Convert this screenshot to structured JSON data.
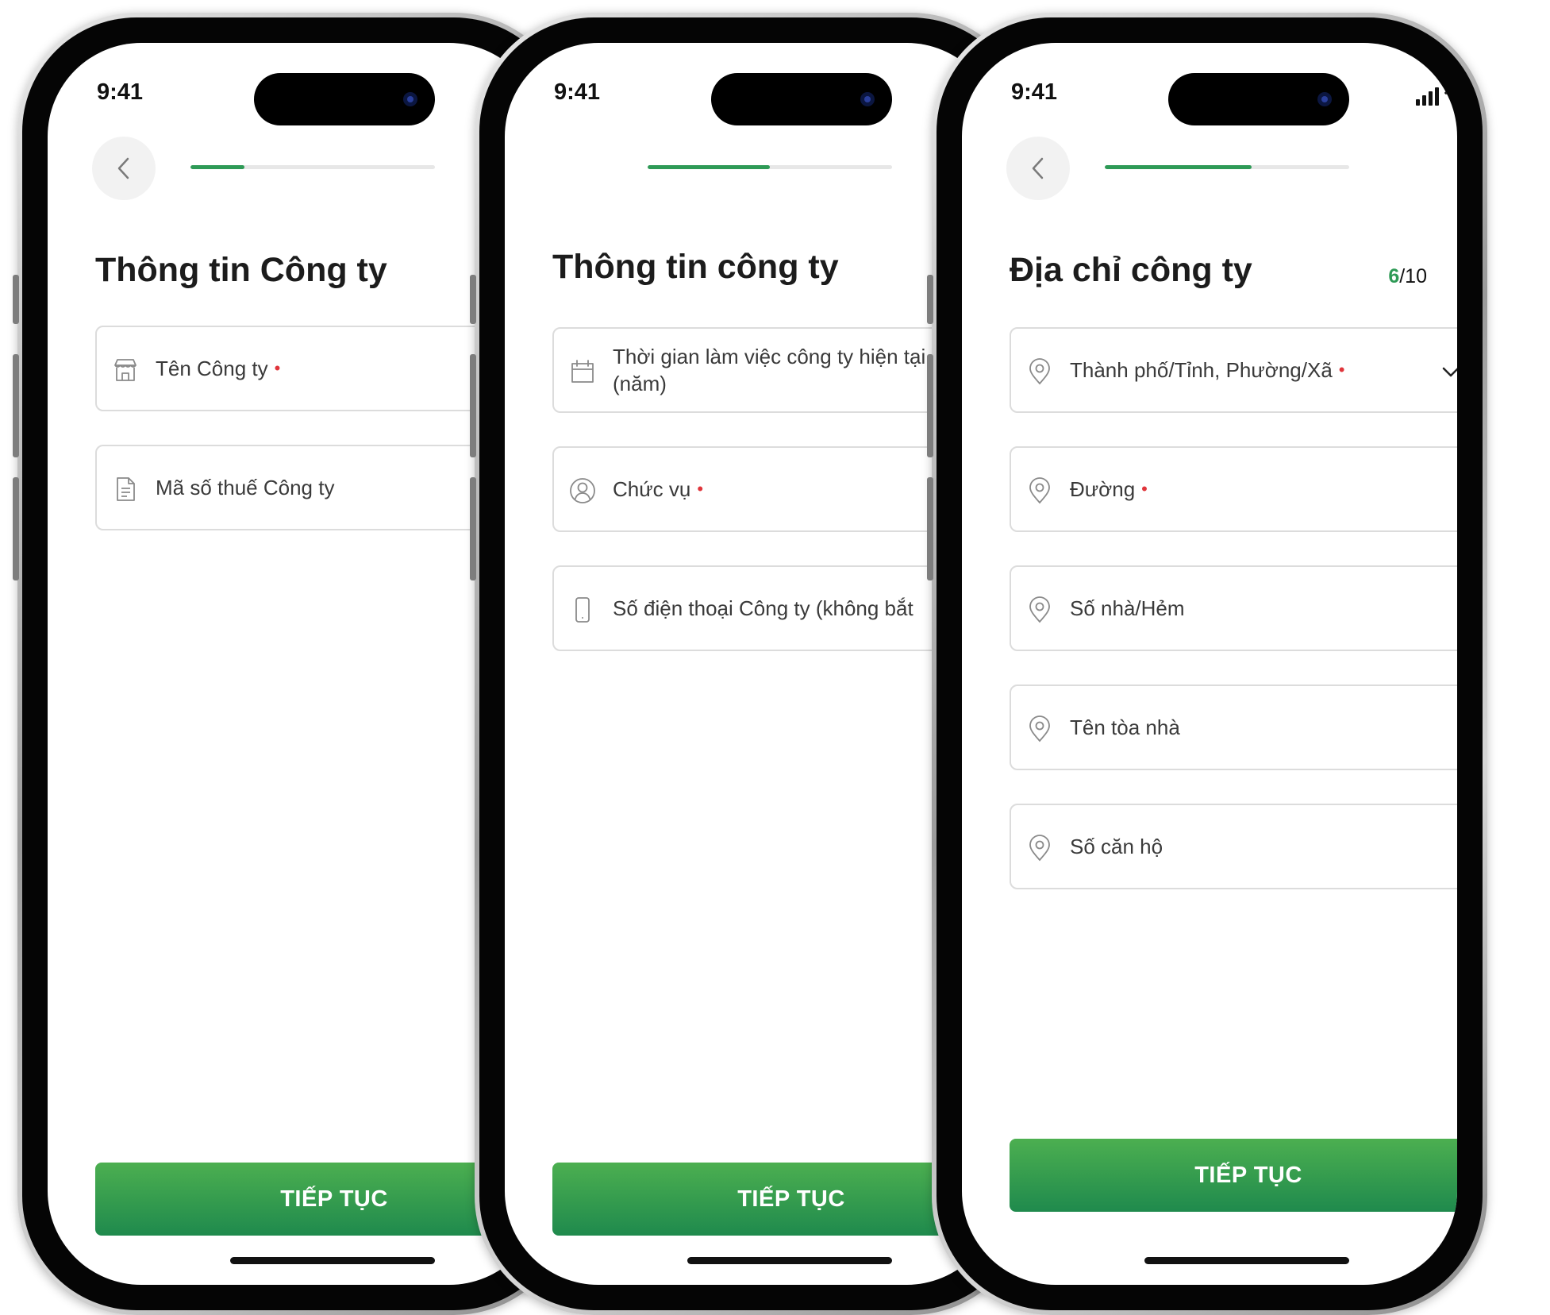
{
  "status_bar": {
    "time": "9:41"
  },
  "screens": [
    {
      "title": "Thông tin Công ty",
      "progress": 0.22,
      "fields": [
        {
          "label": "Tên Công ty",
          "required": "•",
          "icon": "store-icon"
        },
        {
          "label": "Mã số thuế Công ty",
          "icon": "document-icon"
        }
      ],
      "cta": "TIẾP TỤC"
    },
    {
      "title": "Thông tin công ty",
      "progress": 0.5,
      "fields": [
        {
          "label": "Thời gian làm việc công ty hiện tại (năm)",
          "required": "•",
          "icon": "calendar-icon"
        },
        {
          "label": "Chức vụ",
          "required": "•",
          "icon": "user-icon"
        },
        {
          "label": "Số điện thoại Công ty (không bắt",
          "icon": "phone-icon"
        }
      ],
      "cta": "TIẾP TỤC"
    },
    {
      "title": "Địa chỉ công ty",
      "step_current": "6",
      "step_total": "/10",
      "progress": 0.6,
      "fields": [
        {
          "label": "Thành phố/Tỉnh, Phường/Xã",
          "required": "•",
          "icon": "location-pin-icon",
          "dropdown": "chevron-down-icon"
        },
        {
          "label": "Đường",
          "required": "•",
          "icon": "location-pin-icon"
        },
        {
          "label": "Số nhà/Hẻm",
          "icon": "location-pin-icon"
        },
        {
          "label": "Tên tòa nhà",
          "icon": "location-pin-icon"
        },
        {
          "label": "Số căn hộ",
          "icon": "location-pin-icon"
        }
      ],
      "cta": "TIẾP TỤC"
    }
  ],
  "colors": {
    "accent": "#2e9a56",
    "required": "#e0353b",
    "cta_top": "#4caf50",
    "cta_bottom": "#1f8a4d"
  }
}
